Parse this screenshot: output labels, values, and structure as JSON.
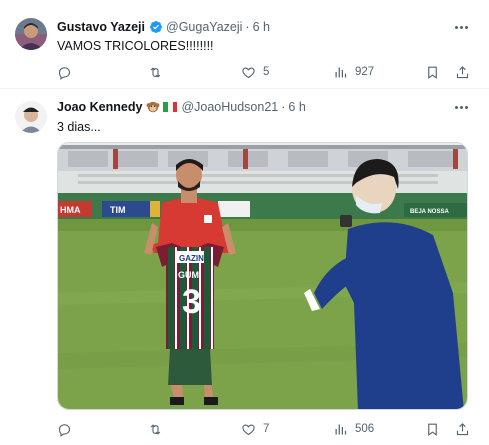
{
  "tweets": [
    {
      "display_name": "Gustavo Yazeji",
      "handle": "@GugaYazeji",
      "time": "6 h",
      "text": "VAMOS TRICOLORES!!!!!!!!",
      "likes": "5",
      "views": "927"
    },
    {
      "display_name": "Joao Kennedy",
      "handle": "@JoaoHudson21",
      "time": "6 h",
      "text": "3 dias...",
      "likes": "7",
      "views": "506",
      "media": {
        "banner_left": "HMA",
        "banner_tim": "TIM",
        "banner_right": "BEJA NOSSA",
        "shirt_sponsor": "GAZIN",
        "shirt_name": "GUM",
        "shirt_number": "3"
      }
    }
  ],
  "icons": {
    "verified": "verified-badge-icon",
    "more": "more-icon",
    "reply": "reply-icon",
    "retweet": "retweet-icon",
    "like": "like-icon",
    "views": "views-icon",
    "bookmark": "bookmark-icon",
    "share": "share-icon",
    "animal_emoji": "monkey-emoji-icon",
    "flag": "italy-flag-icon"
  },
  "colors": {
    "verified": "#1d9bf0",
    "secondary_text": "#536471",
    "pitch": "#7da34a",
    "jersey_maroon": "#7a1e33",
    "jersey_green": "#1e5a3a"
  }
}
